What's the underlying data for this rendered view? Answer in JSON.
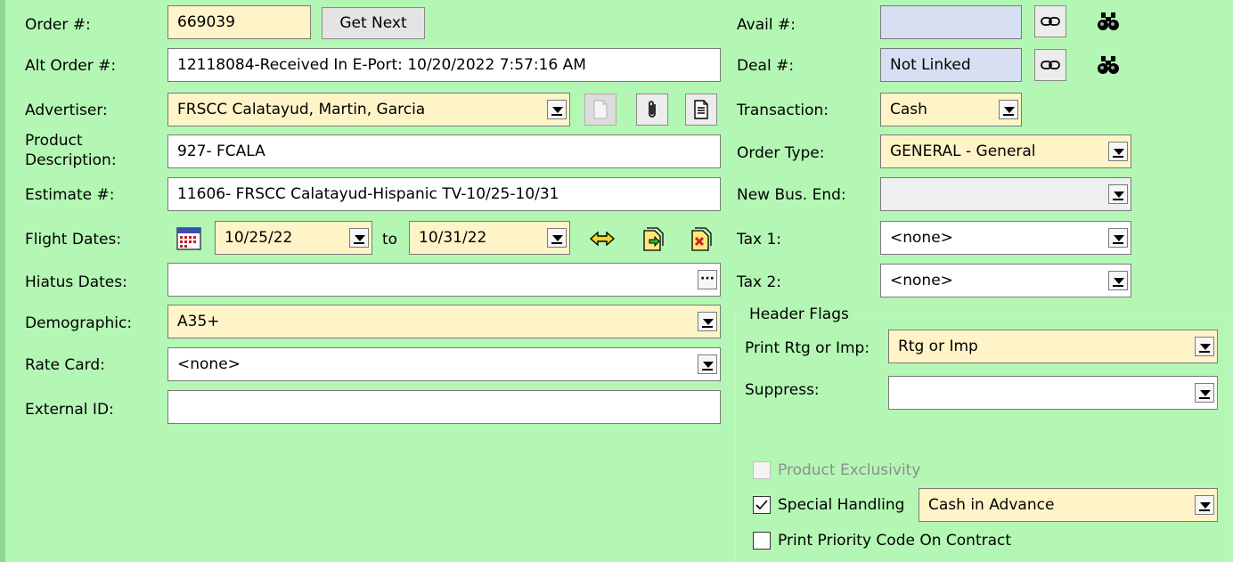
{
  "left": {
    "order_label": "Order #:",
    "order_value": "669039",
    "get_next_label": "Get Next",
    "alt_order_label": "Alt Order #:",
    "alt_order_value": "12118084-Received In E-Port: 10/20/2022 7:57:16 AM",
    "advertiser_label": "Advertiser:",
    "advertiser_value": "FRSCC Calatayud, Martin, Garcia",
    "product_label_line1": "Product",
    "product_label_line2": "Description:",
    "product_value": "927- FCALA",
    "estimate_label": "Estimate #:",
    "estimate_value": "11606- FRSCC Calatayud-Hispanic TV-10/25-10/31",
    "flight_label": "Flight Dates:",
    "flight_start": "10/25/22",
    "flight_to": "to",
    "flight_end": "10/31/22",
    "hiatus_label": "Hiatus Dates:",
    "hiatus_value": "",
    "ellipsis": "···",
    "demographic_label": "Demographic:",
    "demographic_value": "A35+",
    "rate_card_label": "Rate Card:",
    "rate_card_value": "<none>",
    "external_id_label": "External ID:",
    "external_id_value": ""
  },
  "right": {
    "avail_label": "Avail #:",
    "avail_value": "",
    "deal_label": "Deal #:",
    "deal_value": "Not Linked",
    "transaction_label": "Transaction:",
    "transaction_value": "Cash",
    "order_type_label": "Order Type:",
    "order_type_value": "GENERAL - General",
    "new_bus_end_label": "New Bus. End:",
    "new_bus_end_value": "",
    "tax1_label": "Tax 1:",
    "tax1_value": "<none>",
    "tax2_label": "Tax 2:",
    "tax2_value": "<none>"
  },
  "header_flags": {
    "title": "Header Flags",
    "print_rtg_label": "Print Rtg or Imp:",
    "print_rtg_value": "Rtg or Imp",
    "suppress_label": "Suppress:",
    "suppress_value": "",
    "product_exclusivity_label": "Product Exclusivity",
    "product_exclusivity_checked": false,
    "special_handling_label": "Special Handling",
    "special_handling_checked": true,
    "special_handling_value": "Cash in Advance",
    "print_priority_label": "Print Priority Code On Contract",
    "print_priority_checked": false
  },
  "colors": {
    "background": "#b4f7b4",
    "required_field": "#fff4c7",
    "linked_field": "#d6e0f2"
  },
  "icons": [
    "link-icon",
    "binoculars-icon",
    "blank-document-icon",
    "paperclip-icon",
    "notes-icon",
    "calendar-icon",
    "swap-arrows-icon",
    "copy-dates-icon",
    "clear-dates-icon",
    "ellipsis-icon",
    "dropdown-arrow-icon",
    "checkmark-icon"
  ]
}
